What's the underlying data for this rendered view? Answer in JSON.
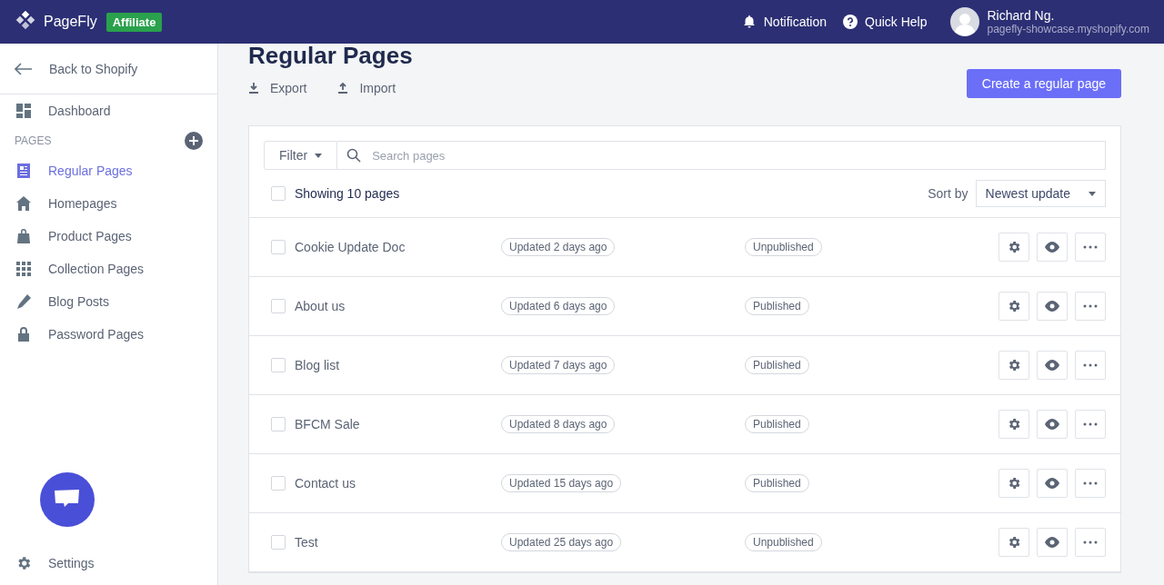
{
  "header": {
    "brand": "PageFly",
    "badge": "Affiliate",
    "notification": "Notification",
    "help": "Quick Help",
    "user": {
      "name": "Richard Ng.",
      "store": "pagefly-showcase.myshopify.com"
    }
  },
  "sidebar": {
    "back": "Back to Shopify",
    "dashboard": "Dashboard",
    "section": "PAGES",
    "items": [
      {
        "label": "Regular Pages",
        "selected": true
      },
      {
        "label": "Homepages",
        "selected": false
      },
      {
        "label": "Product Pages",
        "selected": false
      },
      {
        "label": "Collection Pages",
        "selected": false
      },
      {
        "label": "Blog Posts",
        "selected": false
      },
      {
        "label": "Password Pages",
        "selected": false
      }
    ],
    "settings": "Settings"
  },
  "page": {
    "title": "Regular Pages",
    "actions": [
      {
        "label": "Export"
      },
      {
        "label": "Import"
      }
    ],
    "create_button": "Create a regular page"
  },
  "toolbar": {
    "filter": "Filter",
    "search_placeholder": "Search pages",
    "select_all": {
      "label": "Showing 10 pages",
      "checked": false
    },
    "sort_label": "Sort by",
    "sort_value": "Newest update"
  },
  "rows": [
    {
      "name": "Cookie Update Doc",
      "updated": "Updated 2 days ago",
      "status": "Unpublished",
      "checked": false
    },
    {
      "name": "About us",
      "updated": "Updated 6 days ago",
      "status": "Published",
      "checked": false
    },
    {
      "name": "Blog list",
      "updated": "Updated 7 days ago",
      "status": "Published",
      "checked": false
    },
    {
      "name": "BFCM Sale",
      "updated": "Updated 8 days ago",
      "status": "Published",
      "checked": false
    },
    {
      "name": "Contact us",
      "updated": "Updated 15 days ago",
      "status": "Published",
      "checked": false
    },
    {
      "name": "Test",
      "updated": "Updated 25 days ago",
      "status": "Unpublished",
      "checked": false
    }
  ]
}
